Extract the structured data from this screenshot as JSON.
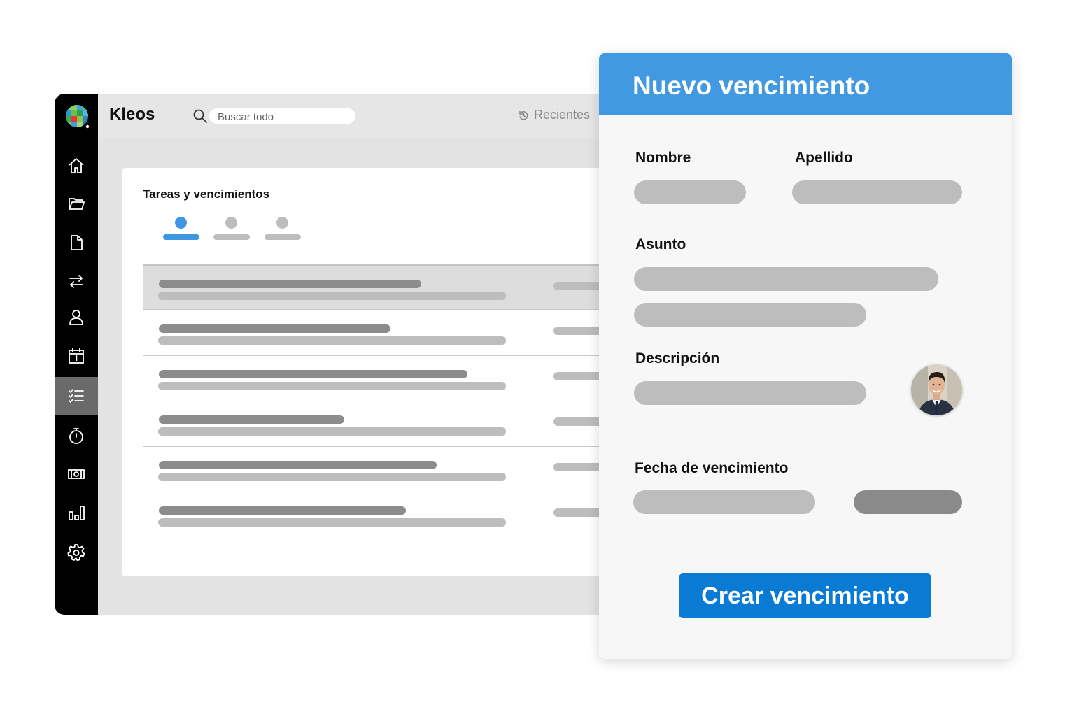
{
  "app": {
    "title": "Kleos",
    "search": {
      "placeholder": "Buscar todo",
      "value": ""
    },
    "recents_label": "Recientes",
    "sidebar_items": [
      {
        "name": "home",
        "icon": "home-icon",
        "active": false
      },
      {
        "name": "folder",
        "icon": "folder-icon",
        "active": false
      },
      {
        "name": "document",
        "icon": "document-icon",
        "active": false
      },
      {
        "name": "transfer",
        "icon": "arrows-icon",
        "active": false
      },
      {
        "name": "contacts",
        "icon": "user-icon",
        "active": false
      },
      {
        "name": "calendar",
        "icon": "calendar-icon",
        "active": false
      },
      {
        "name": "tasks",
        "icon": "checklist-icon",
        "active": true
      },
      {
        "name": "time",
        "icon": "stopwatch-icon",
        "active": false
      },
      {
        "name": "billing",
        "icon": "money-icon",
        "active": false
      },
      {
        "name": "reports",
        "icon": "bar-chart-icon",
        "active": false
      },
      {
        "name": "settings",
        "icon": "gear-icon",
        "active": false
      }
    ],
    "panel": {
      "title": "Tareas y vencimientos",
      "tabs": [
        {
          "active": true,
          "color": "#3f97e3"
        },
        {
          "active": false,
          "color": "#bdbdbd"
        },
        {
          "active": false,
          "color": "#bdbdbd"
        }
      ],
      "rows": [
        {
          "selected": true
        },
        {
          "selected": false
        },
        {
          "selected": false
        },
        {
          "selected": false
        },
        {
          "selected": false
        },
        {
          "selected": false
        }
      ]
    }
  },
  "modal": {
    "title": "Nuevo vencimiento",
    "fields": {
      "first_name_label": "Nombre",
      "last_name_label": "Apellido",
      "subject_label": "Asunto",
      "description_label": "Descripción",
      "due_date_label": "Fecha de vencimiento"
    },
    "submit_label": "Crear vencimiento"
  },
  "colors": {
    "accent": "#4199e2",
    "button": "#0a7bd4",
    "sidebar": "#000000",
    "placeholder_bar": "#bdbdbd"
  }
}
